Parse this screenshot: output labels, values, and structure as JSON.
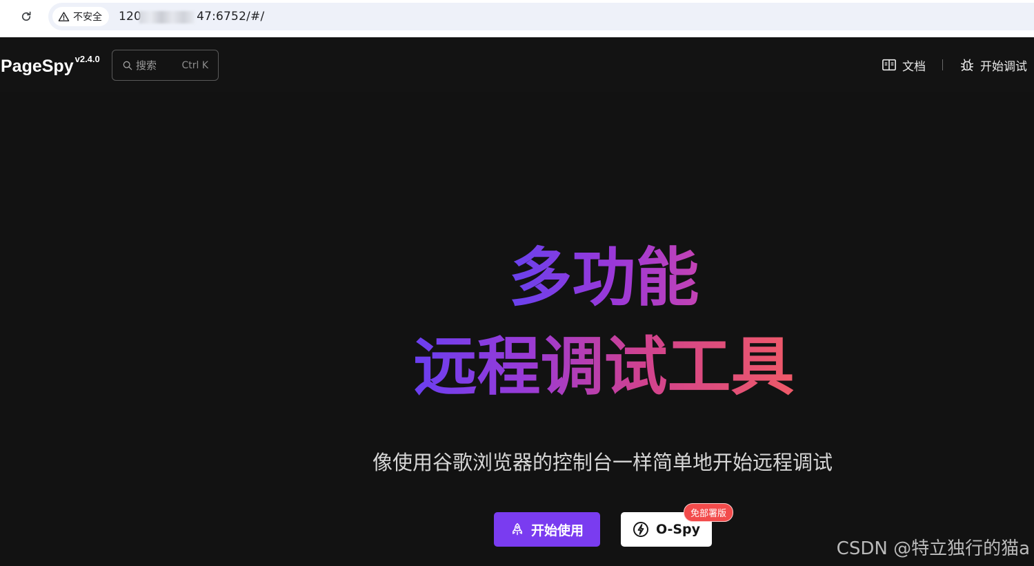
{
  "browser": {
    "security_label": "不安全",
    "url_prefix": "120",
    "url_suffix": "47:6752/#/"
  },
  "navbar": {
    "brand_name": "PageSpy",
    "brand_version": "v2.4.0",
    "search_placeholder": "搜索",
    "search_shortcut": "Ctrl K",
    "links": [
      {
        "label": "文档",
        "icon": "book-icon"
      },
      {
        "label": "开始调试",
        "icon": "bug-icon"
      }
    ]
  },
  "hero": {
    "line1": "多功能",
    "line2": "远程调试工具",
    "subtitle": "像使用谷歌浏览器的控制台一样简单地开始远程调试"
  },
  "cta": {
    "primary_label": "开始使用",
    "secondary_label": "O-Spy",
    "badge": "免部署版"
  },
  "watermark": "CSDN @特立独行的猫a",
  "colors": {
    "background": "#121212",
    "primary": "#7a3cf0",
    "badge": "#f24b4b",
    "gradient_start": "#6842ee",
    "gradient_end": "#ef5a68"
  }
}
